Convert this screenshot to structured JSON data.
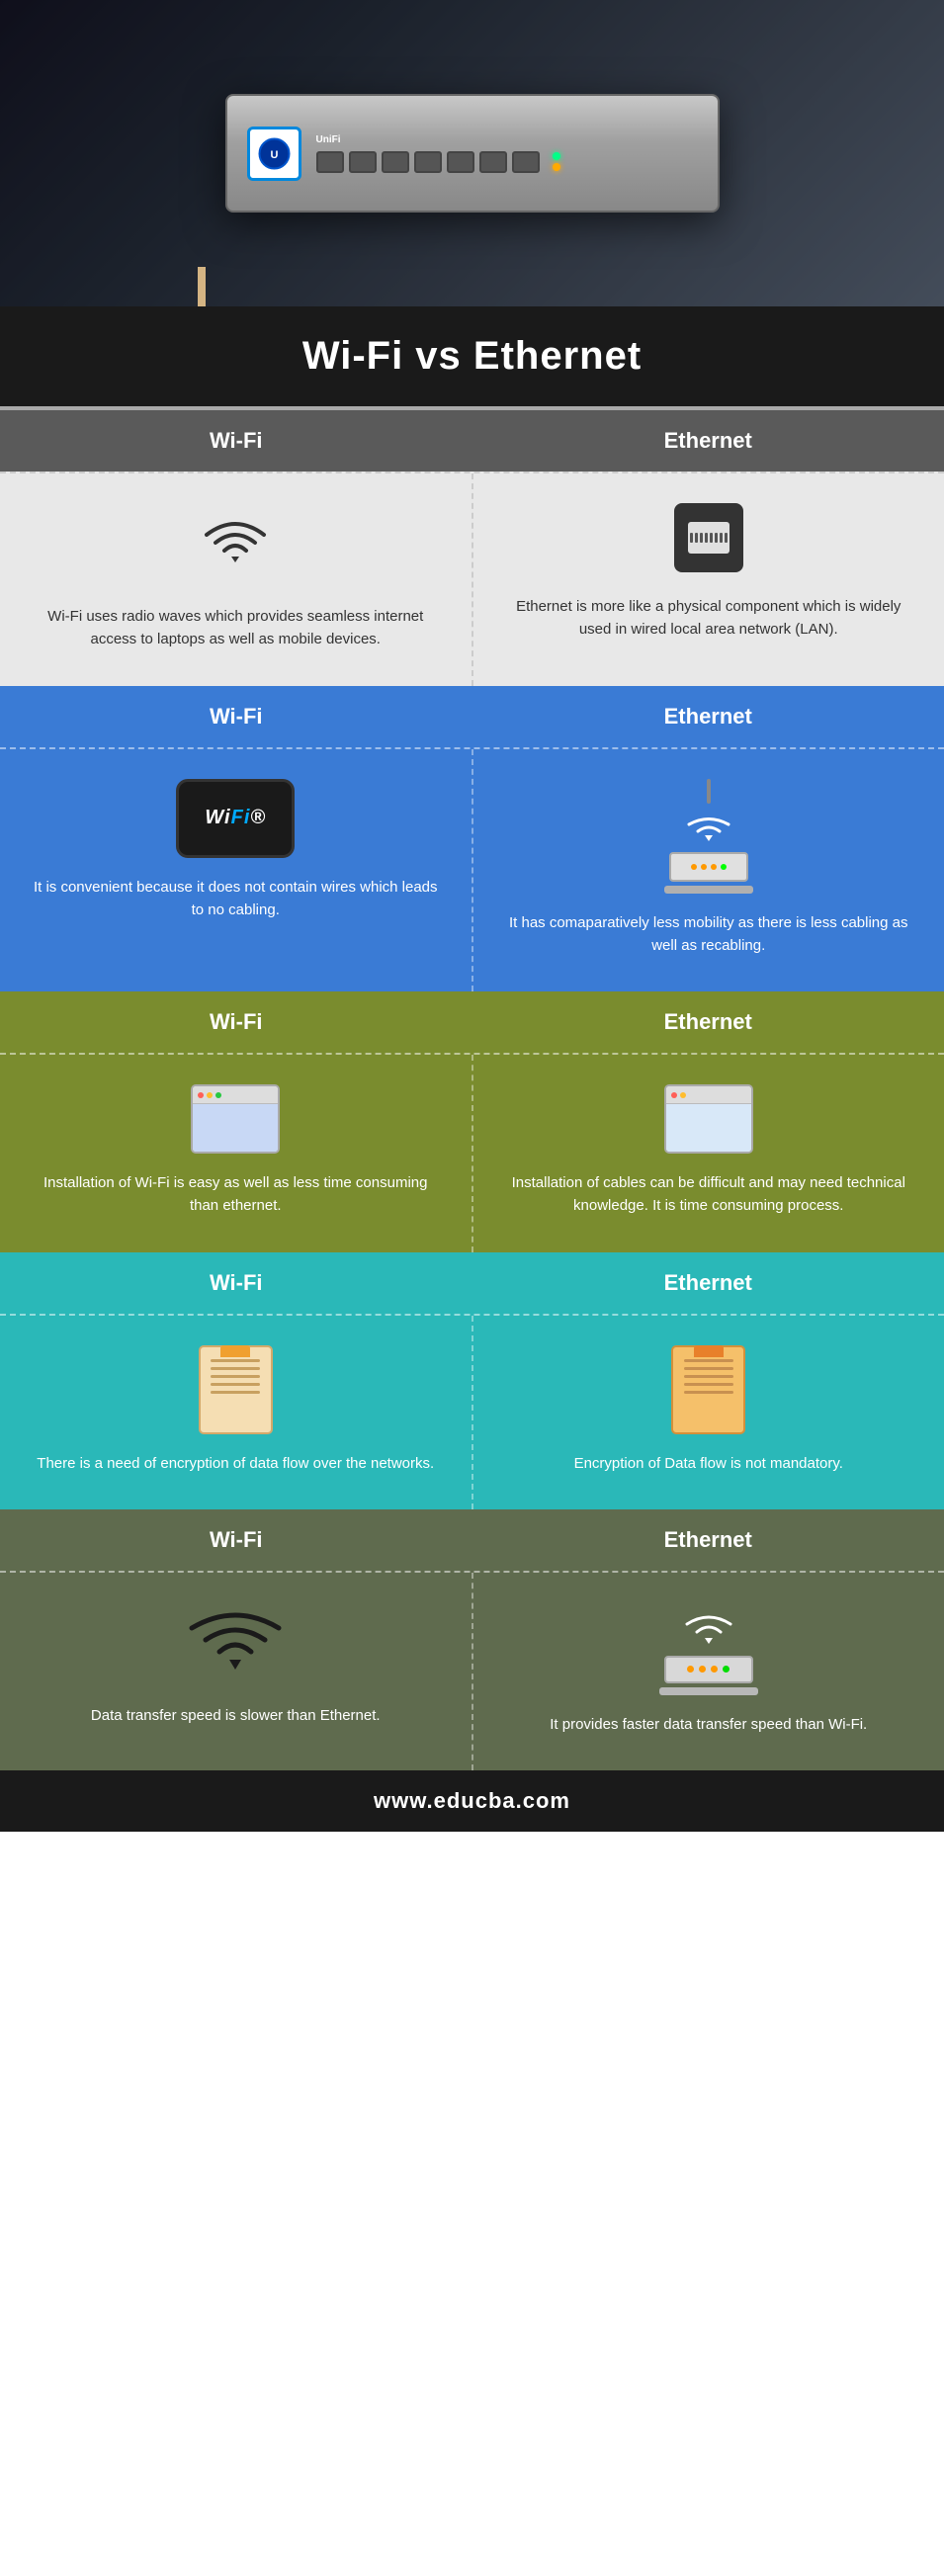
{
  "title": "Wi-Fi vs Ethernet",
  "hero_alt": "Network switch with ethernet cables",
  "sections": [
    {
      "id": "intro",
      "theme": "gray",
      "wifi_label": "Wi-Fi",
      "ethernet_label": "Ethernet",
      "wifi_icon": "wifi-signal",
      "ethernet_icon": "ethernet-port",
      "wifi_text": "Wi-Fi uses radio waves which provides seamless internet access to laptops as well as mobile devices.",
      "ethernet_text": "Ethernet is more like a physical component which is widely used in wired local area network (LAN)."
    },
    {
      "id": "mobility",
      "theme": "blue",
      "wifi_label": "Wi-Fi",
      "ethernet_label": "Ethernet",
      "wifi_icon": "wifi-badge",
      "ethernet_icon": "router",
      "wifi_text": "It is convenient because it does not contain wires which leads to no cabling.",
      "ethernet_text": "It has comaparatively less mobility as there is less cabling as well as recabling."
    },
    {
      "id": "installation",
      "theme": "olive",
      "wifi_label": "Wi-Fi",
      "ethernet_label": "Ethernet",
      "wifi_icon": "browser",
      "ethernet_icon": "browser2",
      "wifi_text": "Installation of Wi-Fi is easy as well as less time consuming than ethernet.",
      "ethernet_text": "Installation of cables can be difficult and may need technical knowledge. It is time consuming process."
    },
    {
      "id": "encryption",
      "theme": "teal",
      "wifi_label": "Wi-Fi",
      "ethernet_label": "Ethernet",
      "wifi_icon": "notepad",
      "ethernet_icon": "notepad2",
      "wifi_text": "There is a need of encryption of data flow over the networks.",
      "ethernet_text": "Encryption of Data flow is not mandatory."
    },
    {
      "id": "speed",
      "theme": "dkgray",
      "wifi_label": "Wi-Fi",
      "ethernet_label": "Ethernet",
      "wifi_icon": "wifi-large",
      "ethernet_icon": "router-large",
      "wifi_text": "Data transfer speed is slower than Ethernet.",
      "ethernet_text": "It provides faster data transfer speed than Wi-Fi."
    }
  ],
  "footer": {
    "url": "www.educba.com"
  },
  "theme_colors": {
    "gray_header": "#5a5a5a",
    "gray_body": "#e8e8e8",
    "blue_header": "#3a7bd5",
    "blue_body": "#3a7bd5",
    "olive_header": "#7a8c2e",
    "olive_body": "#7a8c2e",
    "teal_header": "#2ab8b8",
    "teal_body": "#2ab8b8",
    "dkgray_header": "#5f6b4e",
    "dkgray_body": "#5f6b4e"
  }
}
